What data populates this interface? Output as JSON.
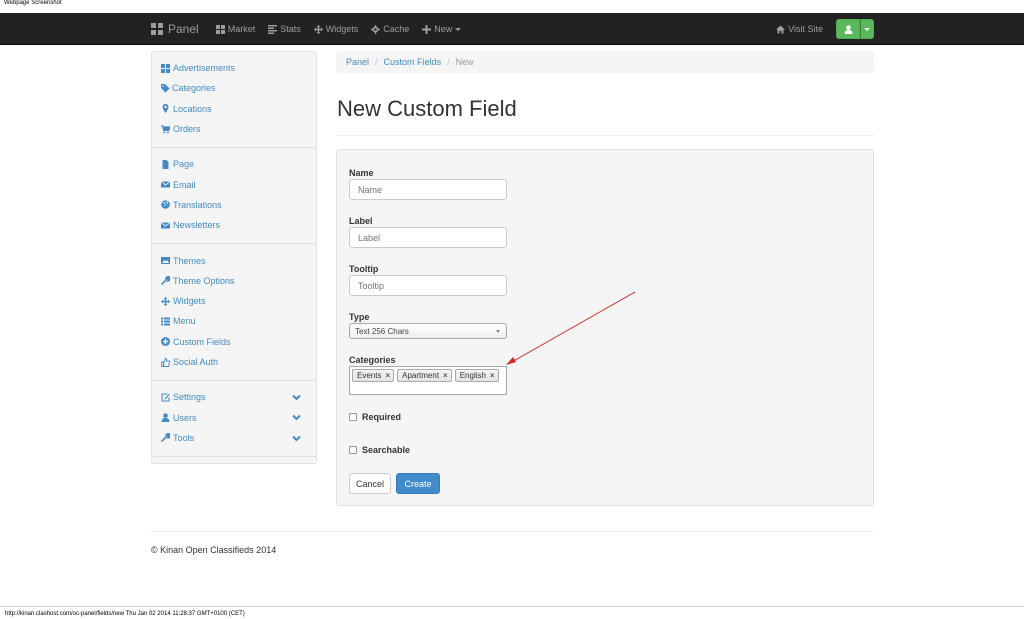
{
  "caption": "Webpage Screenshot",
  "navbar": {
    "brand": "Panel",
    "items": [
      {
        "label": "Market",
        "icon": "th-large-icon"
      },
      {
        "label": "Stats",
        "icon": "align-left-icon"
      },
      {
        "label": "Widgets",
        "icon": "move-icon"
      },
      {
        "label": "Cache",
        "icon": "cog-icon"
      },
      {
        "label": "New",
        "icon": "plus-icon"
      }
    ],
    "visit_site": "Visit Site",
    "user_button_color": "#5cb85c"
  },
  "sidebar": {
    "groups": [
      {
        "items": [
          {
            "label": "Advertisements",
            "icon": "th-large-icon"
          },
          {
            "label": "Categories",
            "icon": "tags-icon"
          },
          {
            "label": "Locations",
            "icon": "map-marker-icon"
          },
          {
            "label": "Orders",
            "icon": "shopping-cart-icon"
          }
        ]
      },
      {
        "items": [
          {
            "label": "Page",
            "icon": "file-icon"
          },
          {
            "label": "Email",
            "icon": "envelope-icon"
          },
          {
            "label": "Translations",
            "icon": "globe-icon"
          },
          {
            "label": "Newsletters",
            "icon": "envelope-icon"
          }
        ]
      },
      {
        "items": [
          {
            "label": "Themes",
            "icon": "picture-icon"
          },
          {
            "label": "Theme Options",
            "icon": "wrench-icon"
          },
          {
            "label": "Widgets",
            "icon": "move-icon"
          },
          {
            "label": "Menu",
            "icon": "list-icon"
          },
          {
            "label": "Custom Fields",
            "icon": "plus-sign-icon"
          },
          {
            "label": "Social Auth",
            "icon": "thumbs-up-icon"
          }
        ]
      },
      {
        "items": [
          {
            "label": "Settings",
            "icon": "edit-icon",
            "expandable": true
          },
          {
            "label": "Users",
            "icon": "user-icon",
            "expandable": true
          },
          {
            "label": "Tools",
            "icon": "wrench-icon",
            "expandable": true
          }
        ]
      }
    ]
  },
  "breadcrumb": {
    "items": [
      "Panel",
      "Custom Fields"
    ],
    "active": "New",
    "separator": "/"
  },
  "page_title": "New Custom Field",
  "form": {
    "name": {
      "label": "Name",
      "placeholder": "Name"
    },
    "label": {
      "label": "Label",
      "placeholder": "Label"
    },
    "tooltip": {
      "label": "Tooltip",
      "placeholder": "Tooltip"
    },
    "type": {
      "label": "Type",
      "selected": "Text 256 Chars"
    },
    "categories": {
      "label": "Categories",
      "tags": [
        "Events",
        "Apartment",
        "English"
      ],
      "remove_glyph": "×"
    },
    "required": {
      "label": "Required",
      "checked": false
    },
    "searchable": {
      "label": "Searchable",
      "checked": false
    },
    "cancel_label": "Cancel",
    "create_label": "Create"
  },
  "footer": "© Kinan Open Classifieds 2014",
  "status_bar": "http://kinan.clashost.com/oc-panel/fields/new Thu Jan 02 2014 11:28:37 GMT+0100 (CET)",
  "colors": {
    "link": "#428bca",
    "primary": "#428bca",
    "success": "#5cb85c",
    "navbar": "#222222",
    "annotation_arrow": "#e02020"
  }
}
